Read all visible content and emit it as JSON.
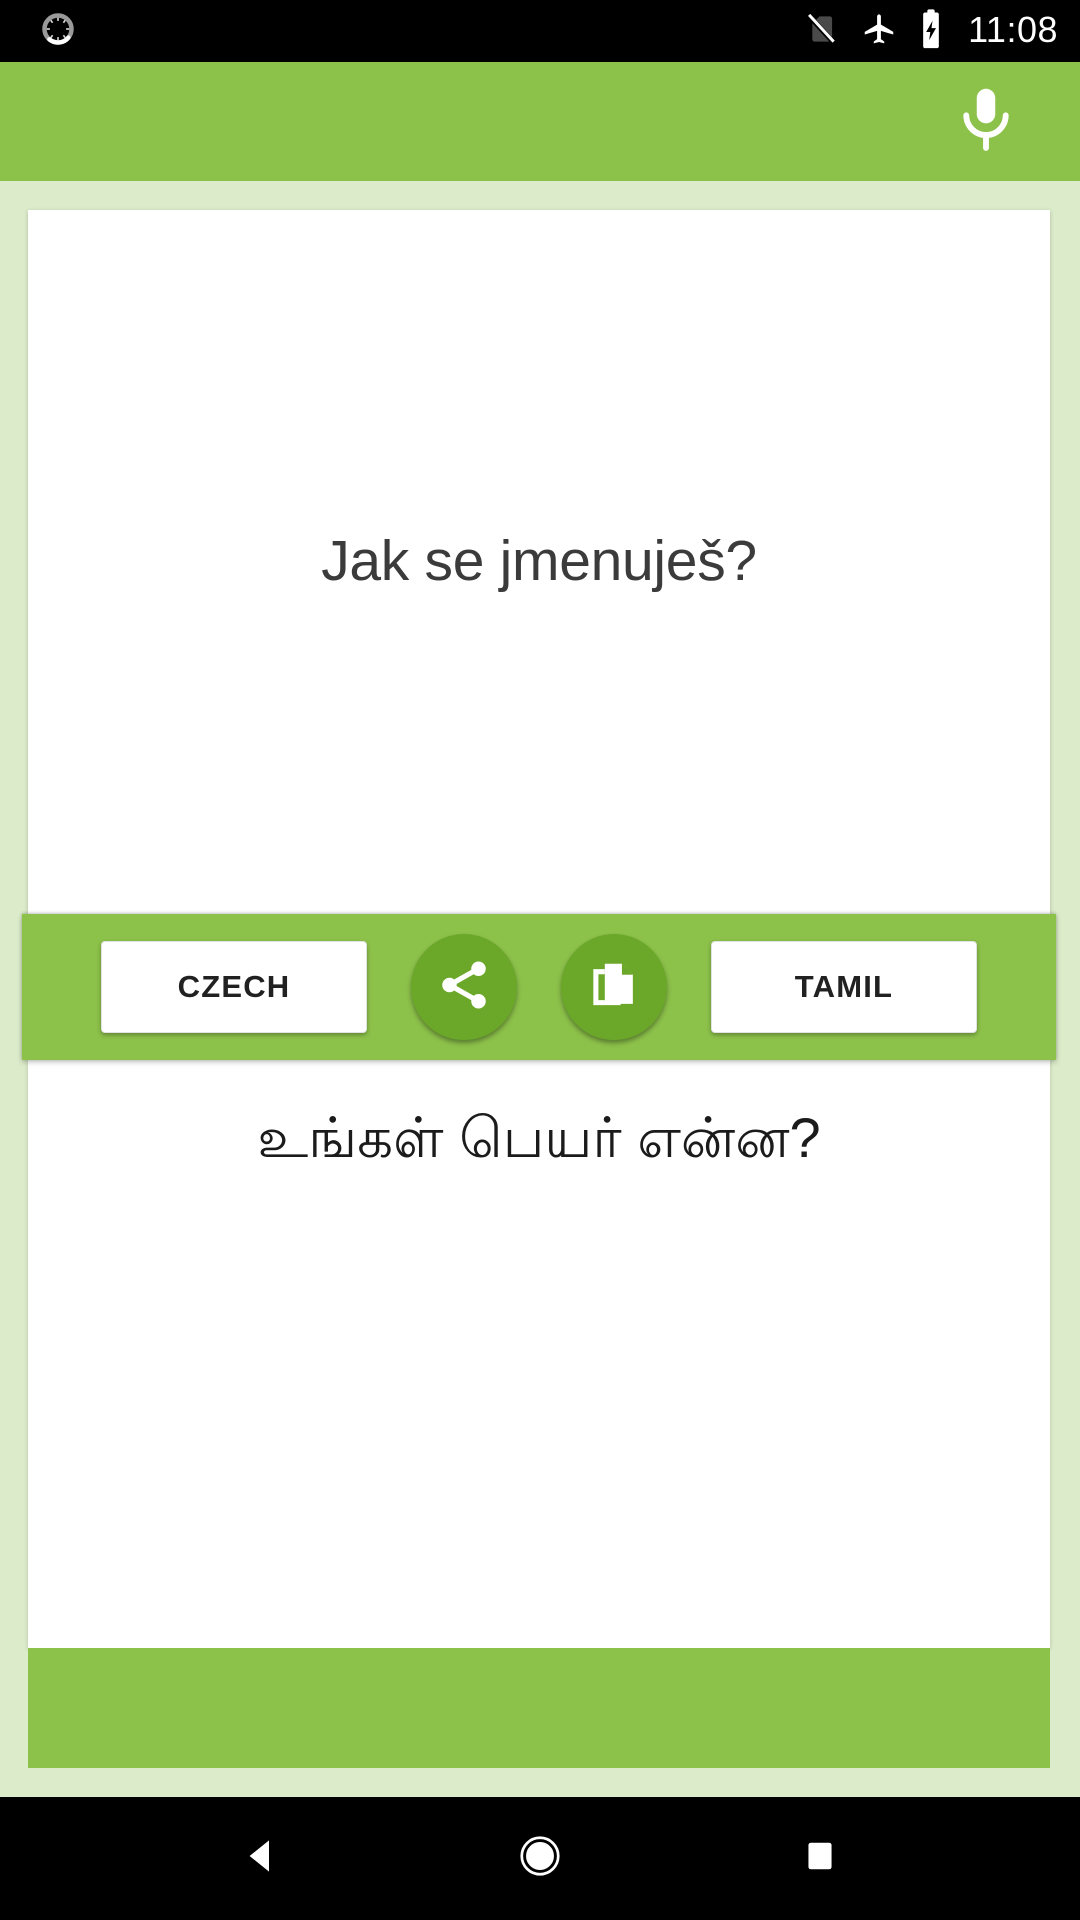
{
  "status_bar": {
    "time": "11:08",
    "left_icons": [
      {
        "name": "sync-spinner-icon"
      }
    ],
    "right_icons": [
      {
        "name": "no-sim-icon"
      },
      {
        "name": "airplane-mode-icon"
      },
      {
        "name": "battery-charging-icon"
      }
    ]
  },
  "app_bar": {
    "mic_icon": "microphone-icon"
  },
  "translator": {
    "source_text": "Jak se jmenuješ?",
    "source_language": "CZECH",
    "target_text": "உங்கள் பெயர் என்ன?",
    "target_language": "TAMIL",
    "share_icon": "share-icon",
    "copy_icon": "copy-icon"
  },
  "nav_bar": {
    "back": "back-triangle-icon",
    "home": "home-circle-icon",
    "recents": "recents-square-icon"
  },
  "colors": {
    "app_green": "#8cc14a",
    "page_background": "#dcecca",
    "button_green": "#6ba82a",
    "status_bar": "#000000",
    "card": "#ffffff"
  }
}
